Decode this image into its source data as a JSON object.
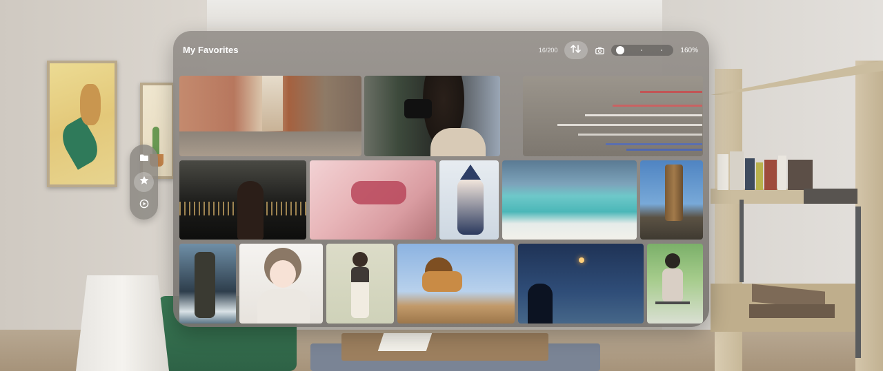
{
  "window": {
    "title": "My Favorites",
    "photo_count": "16/200",
    "zoom_level": "160%",
    "zoom_fraction": 0.05
  },
  "toolbar": {
    "sort_icon": "sort-arrows-icon",
    "camera_icon": "camera-icon"
  },
  "ornament": {
    "items": [
      {
        "icon": "folder-icon",
        "active": false
      },
      {
        "icon": "star-icon",
        "active": true
      },
      {
        "icon": "play-circle-icon",
        "active": false
      }
    ]
  },
  "photos": [
    {
      "name": "photo-street-alley"
    },
    {
      "name": "photo-photographer-camera"
    },
    {
      "name": "photo-jets-airshow"
    },
    {
      "name": "photo-night-city-silhouette"
    },
    {
      "name": "photo-love-necklace"
    },
    {
      "name": "photo-anime-wizard"
    },
    {
      "name": "photo-beach-ocean"
    },
    {
      "name": "photo-rock-pillar"
    },
    {
      "name": "photo-sea-stack"
    },
    {
      "name": "photo-anime-girl-portrait"
    },
    {
      "name": "photo-anime-girl-street"
    },
    {
      "name": "photo-lion"
    },
    {
      "name": "photo-sparkler-silhouette"
    },
    {
      "name": "photo-girl-bicycle"
    }
  ],
  "colors": {
    "window_bg": "#8f8a86",
    "accent_white": "#ffffff"
  }
}
